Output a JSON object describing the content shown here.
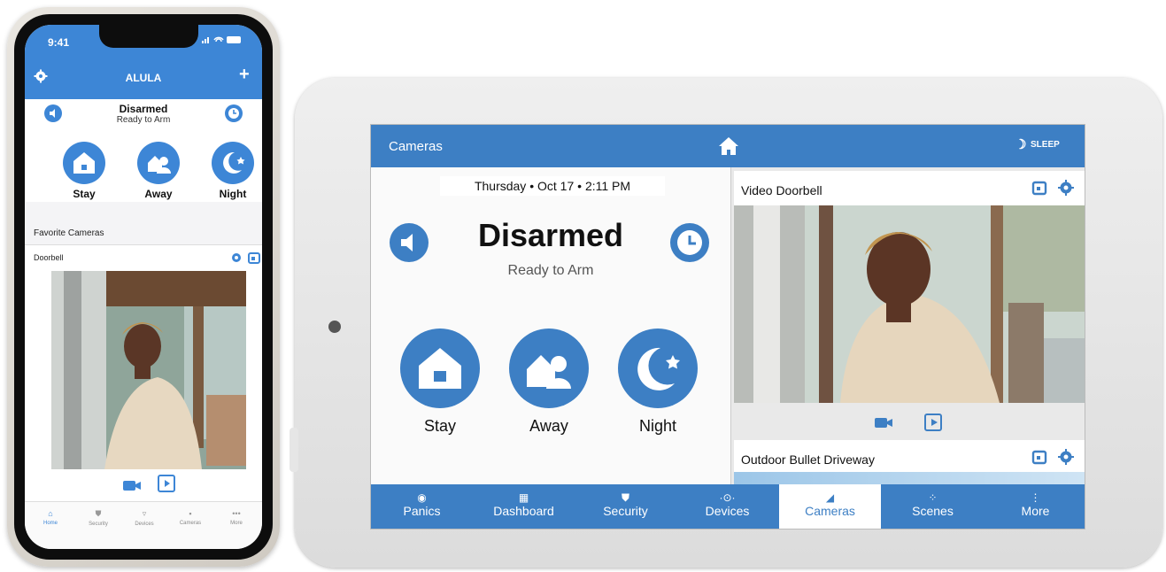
{
  "phone": {
    "status_time": "9:41",
    "header_title": "ALULA",
    "arm_status": "Disarmed",
    "arm_substatus": "Ready to Arm",
    "modes": [
      {
        "label": "Stay",
        "icon": "home-icon"
      },
      {
        "label": "Away",
        "icon": "away-users-icon"
      },
      {
        "label": "Night",
        "icon": "moon-star-icon"
      }
    ],
    "favorites_label": "Favorite Cameras",
    "camera_name": "Doorbell",
    "tabs": [
      {
        "label": "Home",
        "icon": "home-icon",
        "active": true
      },
      {
        "label": "Security",
        "icon": "shield-icon"
      },
      {
        "label": "Devices",
        "icon": "device-icon"
      },
      {
        "label": "Cameras",
        "icon": "camera-icon"
      },
      {
        "label": "More",
        "icon": "more-dots-icon"
      }
    ]
  },
  "tablet": {
    "header_title": "Cameras",
    "sleep_label": "SLEEP",
    "date": "Thursday",
    "date_sep": "•",
    "date_day": "Oct 17",
    "date_time": "2:11 PM",
    "arm_status": "Disarmed",
    "arm_substatus": "Ready to Arm",
    "modes": [
      {
        "label": "Stay",
        "icon": "home-icon"
      },
      {
        "label": "Away",
        "icon": "away-users-icon"
      },
      {
        "label": "Night",
        "icon": "moon-star-icon"
      }
    ],
    "cameras": [
      {
        "name": "Video Doorbell"
      },
      {
        "name": "Outdoor Bullet Driveway"
      }
    ],
    "nav": [
      {
        "label": "Panics",
        "icon": "panic-icon"
      },
      {
        "label": "Dashboard",
        "icon": "dashboard-icon"
      },
      {
        "label": "Security",
        "icon": "shield-icon"
      },
      {
        "label": "Devices",
        "icon": "device-icon"
      },
      {
        "label": "Cameras",
        "icon": "camera-icon",
        "active": true
      },
      {
        "label": "Scenes",
        "icon": "scenes-icon"
      },
      {
        "label": "More",
        "icon": "more-icon"
      }
    ]
  },
  "colors": {
    "brand_blue": "#3d7fc4",
    "phone_blue": "#3d86d6"
  }
}
